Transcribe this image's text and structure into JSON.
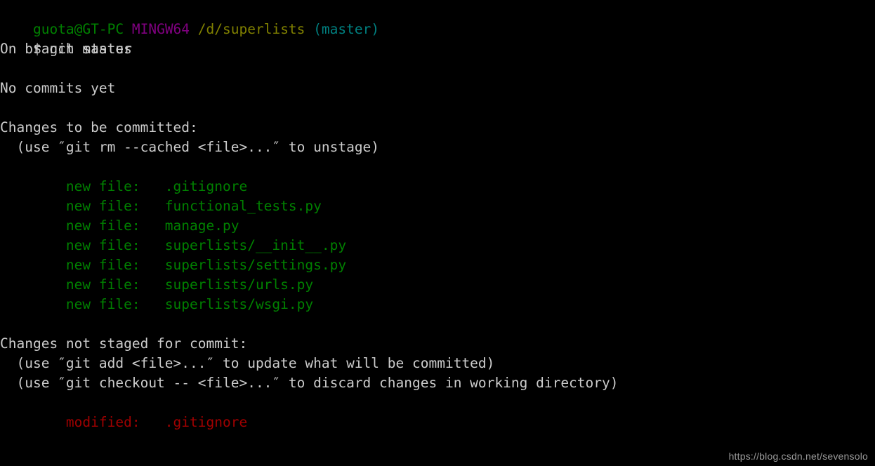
{
  "terminal": {
    "title": "MINGW64 /d/superlists",
    "background_color": "#000000",
    "default_text_color": "#cccccc",
    "colors": {
      "user": "#008000",
      "shell": "#800080",
      "path": "#808000",
      "branch": "#008080",
      "added": "#008000",
      "removed": "#a00000",
      "watermark": "#9a9a9a"
    },
    "prompt": {
      "user_host": "guota@GT-PC",
      "shell": "MINGW64",
      "path": "/d/superlists",
      "branch": "(master)",
      "sigil": "$ ",
      "command": "git status"
    },
    "lines": [
      {
        "type": "prompt"
      },
      {
        "type": "command"
      },
      {
        "type": "text",
        "text": "On branch master"
      },
      {
        "type": "blank",
        "text": ""
      },
      {
        "type": "text",
        "text": "No commits yet"
      },
      {
        "type": "blank",
        "text": ""
      },
      {
        "type": "text",
        "text": "Changes to be committed:"
      },
      {
        "type": "text",
        "text": "  (use ″git rm --cached <file>...″ to unstage)"
      },
      {
        "type": "blank",
        "text": ""
      },
      {
        "type": "added",
        "text": "        new file:   .gitignore"
      },
      {
        "type": "added",
        "text": "        new file:   functional_tests.py"
      },
      {
        "type": "added",
        "text": "        new file:   manage.py"
      },
      {
        "type": "added",
        "text": "        new file:   superlists/__init__.py"
      },
      {
        "type": "added",
        "text": "        new file:   superlists/settings.py"
      },
      {
        "type": "added",
        "text": "        new file:   superlists/urls.py"
      },
      {
        "type": "added",
        "text": "        new file:   superlists/wsgi.py"
      },
      {
        "type": "blank",
        "text": ""
      },
      {
        "type": "text",
        "text": "Changes not staged for commit:"
      },
      {
        "type": "text",
        "text": "  (use ″git add <file>...″ to update what will be committed)"
      },
      {
        "type": "text",
        "text": "  (use ″git checkout -- <file>...″ to discard changes in working directory)"
      },
      {
        "type": "blank",
        "text": ""
      },
      {
        "type": "removed",
        "text": "        modified:   .gitignore"
      }
    ]
  },
  "watermark": {
    "text": "https://blog.csdn.net/sevensolo"
  }
}
